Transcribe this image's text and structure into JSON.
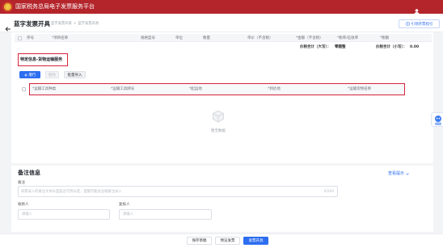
{
  "header": {
    "title": "国家税务总局电子发票服务平台"
  },
  "subheader": {
    "title": "蓝字发票开具",
    "breadcrumb": [
      "蓝字发票开具",
      "蓝字发票开具"
    ],
    "breadcrumb_separator": ">",
    "guide_button": "引领开票指引"
  },
  "items_table": {
    "columns": [
      "序号",
      "*项目名称",
      "规格型号",
      "单位",
      "数量",
      "单价（不含税）",
      "*金额（不含税）",
      "*税率/征收率",
      "*税额"
    ],
    "total_upper_label": "价税合计（大写）：",
    "total_upper_value": "零圆整",
    "total_lower_label": "价税合计（小写）：",
    "total_lower_value": "0.00"
  },
  "special_info": {
    "title": "特定信息-货物运输服务",
    "buttons": {
      "add": "增行",
      "delete": "删除",
      "import": "批量导入"
    },
    "columns": [
      "*运输工具种类",
      "*运输工具牌号",
      "*起运地",
      "*到达地",
      "*运输货物名称"
    ],
    "empty_text": "暂无数据"
  },
  "remarks": {
    "title": "备注信息",
    "toggle": "查看提示",
    "remark_label": "备注",
    "remark_placeholder": "如需录入的备注文本长度超过可用长度，提醒可能会压缩备注录入",
    "remark_count": "0/200",
    "payee_label": "收款人",
    "payee_placeholder": "请输入",
    "reviewer_label": "复核人",
    "reviewer_placeholder": "请输入"
  },
  "footer": {
    "save_draft": "保存草稿",
    "preview": "预览发票",
    "issue": "发票开具"
  },
  "icons": {
    "logo": "national-emblem-icon",
    "user": "user-icon",
    "back": "arrow-left-icon",
    "guide": "guide-icon",
    "add": "plus-icon",
    "empty": "empty-box-icon",
    "toggle": "chevron-down-icon",
    "assistant": "assistant-icon"
  },
  "colors": {
    "header": "#b4252b",
    "primary": "#2d6ef0",
    "highlight": "#d6233a"
  }
}
